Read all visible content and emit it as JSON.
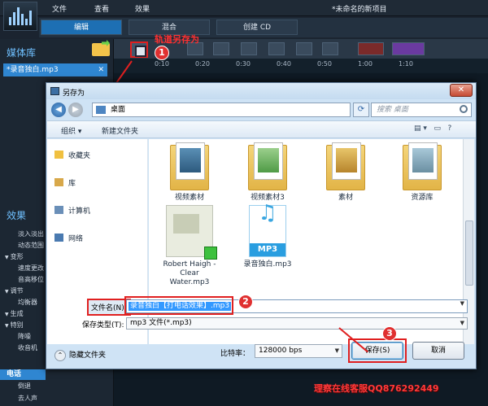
{
  "app": {
    "menu": [
      "文件",
      "查看",
      "效果"
    ],
    "project_title": "*未命名的新项目",
    "tabs": [
      "编辑",
      "混合",
      "创建 CD"
    ]
  },
  "sidebar": {
    "media_library": "媒体库",
    "media_item": "*录音独白.mp3",
    "effects_title": "效果",
    "effects": [
      {
        "label": "淡入淡出",
        "type": "sub"
      },
      {
        "label": "动态范围",
        "type": "sub"
      },
      {
        "label": "变形",
        "type": "cat"
      },
      {
        "label": "速度更改",
        "type": "sub"
      },
      {
        "label": "音高移位",
        "type": "sub"
      },
      {
        "label": "调节",
        "type": "cat"
      },
      {
        "label": "均衡器",
        "type": "sub"
      },
      {
        "label": "生成",
        "type": "cat"
      },
      {
        "label": "特别",
        "type": "cat"
      },
      {
        "label": "降噪",
        "type": "sub"
      },
      {
        "label": "收音机",
        "type": "sub"
      }
    ],
    "active_effect": "电话",
    "after_effects": [
      "倒退",
      "去人声"
    ]
  },
  "timeline": {
    "ticks": [
      "0:10",
      "0:20",
      "0:30",
      "0:40",
      "0:50",
      "1:00",
      "1:10"
    ]
  },
  "annotations": {
    "track_save_label": "轨道另存为",
    "step1": "1",
    "step2": "2",
    "step3": "3",
    "watermark": "理察在线客服QQ876292449",
    "accent": "#e02020"
  },
  "dialog": {
    "title": "另存为",
    "close": "✕",
    "address": "桌面",
    "search_placeholder": "搜索 桌面",
    "commands": {
      "organize": "组织 ▾",
      "new_folder": "新建文件夹"
    },
    "nav": [
      {
        "label": "收藏夹",
        "icon": "star-icon"
      },
      {
        "label": "库",
        "icon": "library-icon"
      },
      {
        "label": "计算机",
        "icon": "computer-icon"
      },
      {
        "label": "网络",
        "icon": "network-icon"
      }
    ],
    "files_row1": [
      {
        "label": "视频素材",
        "kind": "folder"
      },
      {
        "label": "视频素材3",
        "kind": "folder"
      },
      {
        "label": "素材",
        "kind": "folder"
      },
      {
        "label": "资源库",
        "kind": "folder"
      }
    ],
    "files_row2": [
      {
        "label": "Robert Haigh - Clear Water.mp3",
        "kind": "cover"
      },
      {
        "label": "录音独白.mp3",
        "kind": "mp3"
      }
    ],
    "mp3_badge": "MP3",
    "filename_label": "文件名(N):",
    "filename_value": "录音独白【打电话效果】.mp3",
    "filetype_label": "保存类型(T):",
    "filetype_value": "mp3 文件(*.mp3)",
    "hide_folders": "隐藏文件夹",
    "bitrate_label": "比特率：",
    "bitrate_value": "128000 bps",
    "save": "保存(S)",
    "cancel": "取消"
  }
}
